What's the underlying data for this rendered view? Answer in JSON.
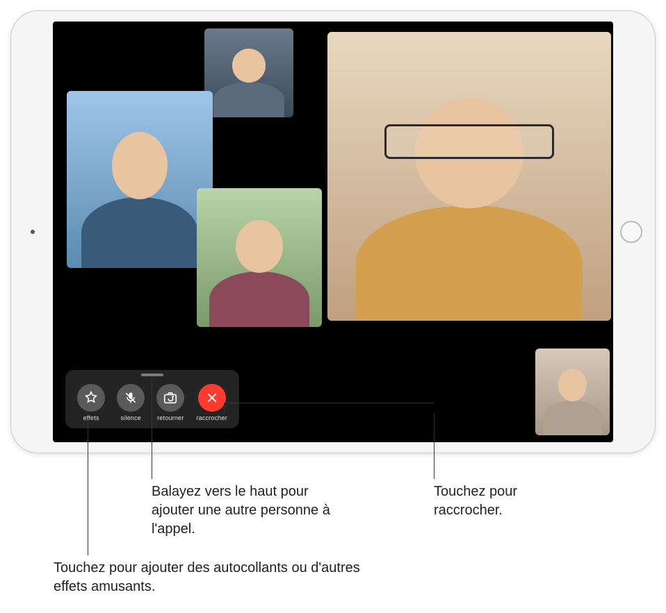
{
  "controls": {
    "effects": "effets",
    "mute": "silence",
    "flip": "retourner",
    "end": "raccrocher"
  },
  "callouts": {
    "swipe_up": "Balayez vers le haut pour ajouter une autre personne à l'appel.",
    "end_call": "Touchez pour raccrocher.",
    "effects": "Touchez pour ajouter des autocollants ou d'autres effets amusants."
  }
}
